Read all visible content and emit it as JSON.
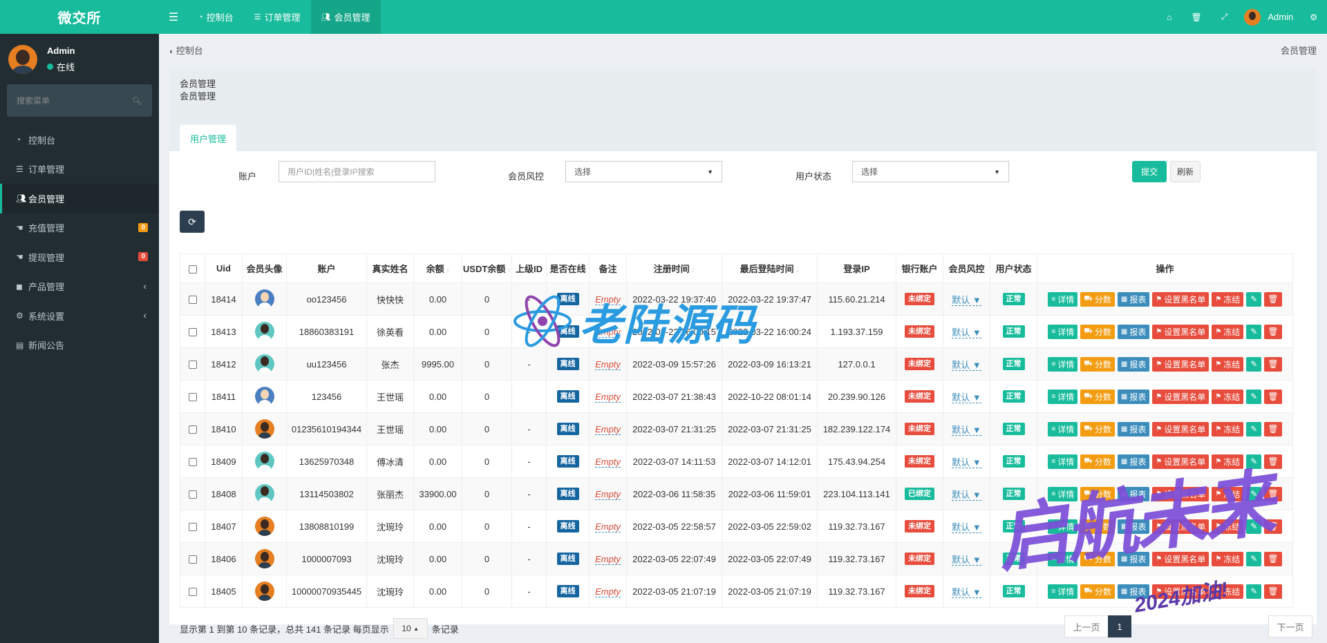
{
  "brand": "微交所",
  "sidebar": {
    "user_name": "Admin",
    "user_status": "在线",
    "search_placeholder": "搜索菜单",
    "items": [
      {
        "label": "控制台",
        "icon": "dashboard-icon"
      },
      {
        "label": "订单管理",
        "icon": "list-icon"
      },
      {
        "label": "会员管理",
        "icon": "users-icon",
        "active": true
      },
      {
        "label": "充值管理",
        "icon": "hand-icon",
        "badge": "0",
        "badge_color": "#f39c12"
      },
      {
        "label": "提现管理",
        "icon": "hand-icon",
        "badge": "0",
        "badge_color": "#e74c3c"
      },
      {
        "label": "产品管理",
        "icon": "bag-icon",
        "arrow": "‹"
      },
      {
        "label": "系统设置",
        "icon": "cogs-icon",
        "arrow": "‹"
      },
      {
        "label": "新闻公告",
        "icon": "news-icon"
      }
    ]
  },
  "topbar": {
    "tabs": [
      {
        "label": "控制台",
        "icon": "dashboard-icon"
      },
      {
        "label": "订单管理",
        "icon": "list-icon"
      },
      {
        "label": "会员管理",
        "icon": "users-icon",
        "active": true
      }
    ],
    "user_name": "Admin"
  },
  "breadcrumb": {
    "home": "控制台",
    "current": "会员管理"
  },
  "panel": {
    "title": "会员管理",
    "subtitle": "会员管理",
    "tab": "用户管理"
  },
  "filters": {
    "account_label": "账户",
    "account_placeholder": "用户ID|姓名|登录IP搜索",
    "risk_label": "会员风控",
    "risk_value": "选择",
    "status_label": "用户状态",
    "status_value": "选择",
    "submit": "提交",
    "reset": "刷新"
  },
  "table": {
    "headers": [
      "",
      "Uid",
      "会员头像",
      "账户",
      "真实姓名",
      "余额",
      "USDT余额",
      "上级ID",
      "是否在线",
      "备注",
      "注册时间",
      "最后登陆时间",
      "登录IP",
      "银行账户",
      "会员风控",
      "用户状态",
      "操作"
    ],
    "ops": [
      {
        "label": "详情",
        "icon": "≡",
        "color": "teal"
      },
      {
        "label": "分数",
        "icon": "⛟",
        "color": "orange"
      },
      {
        "label": "报表",
        "icon": "▦",
        "color": "blue"
      },
      {
        "label": "设置黑名单",
        "icon": "⚑",
        "color": "red"
      },
      {
        "label": "冻结",
        "icon": "⚑",
        "color": "red"
      },
      {
        "label": "",
        "icon": "✎",
        "color": "green"
      },
      {
        "label": "",
        "icon": "🗑",
        "color": "red"
      }
    ],
    "rows": [
      {
        "uid": "18414",
        "avatar": "blue",
        "account": "oo123456",
        "name": "快快快",
        "balance": "0.00",
        "usdt": "0",
        "parent": "-",
        "online": "离线",
        "remark": "Empty",
        "reg": "2022-03-22 19:37:40",
        "last": "2022-03-22 19:37:47",
        "ip": "115.60.21.214",
        "bank": "未绑定",
        "bank_color": "red",
        "risk": "默认",
        "status": "正常"
      },
      {
        "uid": "18413",
        "avatar": "teal",
        "account": "18860383191",
        "name": "徐英看",
        "balance": "0.00",
        "usdt": "0",
        "parent": "-",
        "online": "离线",
        "remark": "Empty",
        "reg": "2022-03-22 16:00:15",
        "last": "2022-03-22 16:00:24",
        "ip": "1.193.37.159",
        "bank": "未绑定",
        "bank_color": "red",
        "risk": "默认",
        "status": "正常"
      },
      {
        "uid": "18412",
        "avatar": "teal",
        "account": "uu123456",
        "name": "张杰",
        "balance": "9995.00",
        "usdt": "0",
        "parent": "-",
        "online": "离线",
        "remark": "Empty",
        "reg": "2022-03-09 15:57:26",
        "last": "2022-03-09 16:13:21",
        "ip": "127.0.0.1",
        "bank": "未绑定",
        "bank_color": "red",
        "risk": "默认",
        "status": "正常"
      },
      {
        "uid": "18411",
        "avatar": "blue",
        "account": "123456",
        "name": "王世瑶",
        "balance": "0.00",
        "usdt": "0",
        "parent": "",
        "online": "离线",
        "remark": "Empty",
        "reg": "2022-03-07 21:38:43",
        "last": "2022-10-22 08:01:14",
        "ip": "20.239.90.126",
        "bank": "未绑定",
        "bank_color": "red",
        "risk": "默认",
        "status": "正常"
      },
      {
        "uid": "18410",
        "avatar": "orange",
        "account": "01235610194344",
        "name": "王世瑶",
        "balance": "0.00",
        "usdt": "0",
        "parent": "-",
        "online": "离线",
        "remark": "Empty",
        "reg": "2022-03-07 21:31:25",
        "last": "2022-03-07 21:31:25",
        "ip": "182.239.122.174",
        "bank": "未绑定",
        "bank_color": "red",
        "risk": "默认",
        "status": "正常"
      },
      {
        "uid": "18409",
        "avatar": "teal",
        "account": "13625970348",
        "name": "傅冰清",
        "balance": "0.00",
        "usdt": "0",
        "parent": "-",
        "online": "离线",
        "remark": "Empty",
        "reg": "2022-03-07 14:11:53",
        "last": "2022-03-07 14:12:01",
        "ip": "175.43.94.254",
        "bank": "未绑定",
        "bank_color": "red",
        "risk": "默认",
        "status": "正常"
      },
      {
        "uid": "18408",
        "avatar": "teal",
        "account": "13114503802",
        "name": "张丽杰",
        "balance": "33900.00",
        "usdt": "0",
        "parent": "-",
        "online": "离线",
        "remark": "Empty",
        "reg": "2022-03-06 11:58:35",
        "last": "2022-03-06 11:59:01",
        "ip": "223.104.113.141",
        "bank": "已绑定",
        "bank_color": "green",
        "risk": "默认",
        "status": "正常"
      },
      {
        "uid": "18407",
        "avatar": "orange",
        "account": "13808810199",
        "name": "沈琬玲",
        "balance": "0.00",
        "usdt": "0",
        "parent": "-",
        "online": "离线",
        "remark": "Empty",
        "reg": "2022-03-05 22:58:57",
        "last": "2022-03-05 22:59:02",
        "ip": "119.32.73.167",
        "bank": "未绑定",
        "bank_color": "red",
        "risk": "默认",
        "status": "正常"
      },
      {
        "uid": "18406",
        "avatar": "orange",
        "account": "1000007093",
        "name": "沈琬玲",
        "balance": "0.00",
        "usdt": "0",
        "parent": "-",
        "online": "离线",
        "remark": "Empty",
        "reg": "2022-03-05 22:07:49",
        "last": "2022-03-05 22:07:49",
        "ip": "119.32.73.167",
        "bank": "未绑定",
        "bank_color": "red",
        "risk": "默认",
        "status": "正常"
      },
      {
        "uid": "18405",
        "avatar": "orange",
        "account": "10000070935445",
        "name": "沈琬玲",
        "balance": "0.00",
        "usdt": "0",
        "parent": "-",
        "online": "离线",
        "remark": "Empty",
        "reg": "2022-03-05 21:07:19",
        "last": "2022-03-05 21:07:19",
        "ip": "119.32.73.167",
        "bank": "未绑定",
        "bank_color": "red",
        "risk": "默认",
        "status": "正常"
      }
    ]
  },
  "pager": {
    "info_prefix": "显示第 1 到第 10 条记录，总共 141 条记录 每页显示",
    "page_size": "10",
    "info_suffix": "条记录",
    "prev": "上一页",
    "current": "1",
    "next": "下一页"
  },
  "watermarks": {
    "center": "老陆源码",
    "corner": "启航未来",
    "corner_sub": "2024加油!"
  }
}
